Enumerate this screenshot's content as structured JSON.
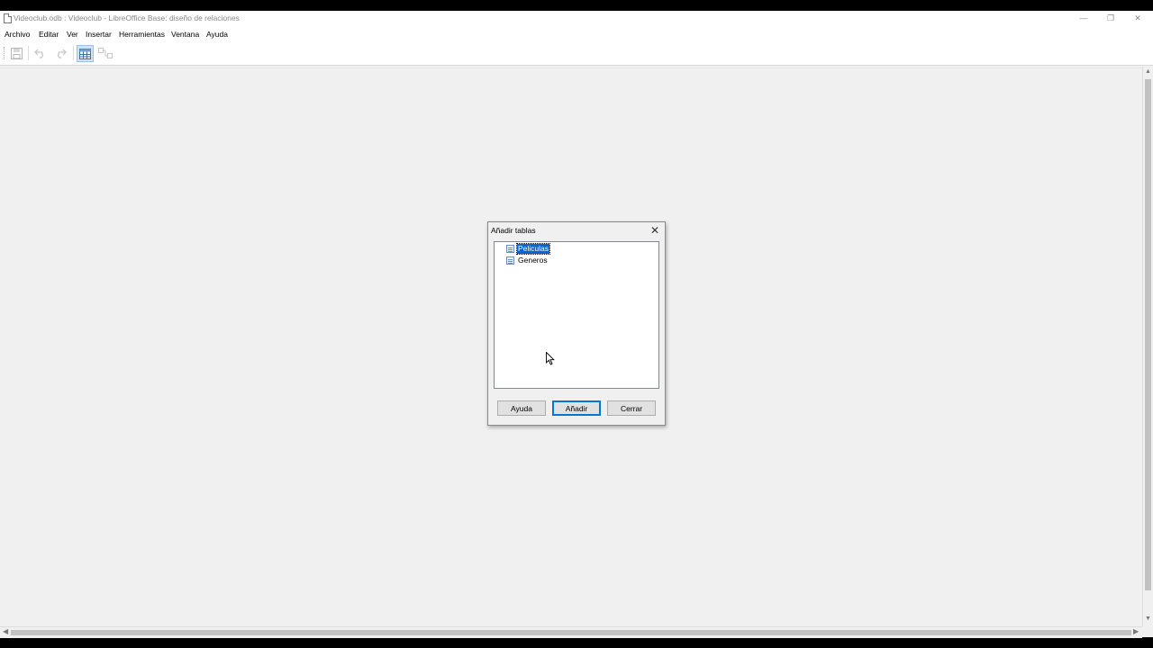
{
  "window": {
    "title": "Videoclub.odb : Videoclub - LibreOffice Base: diseño de relaciones"
  },
  "menu": [
    "Archivo",
    "Editar",
    "Ver",
    "Insertar",
    "Herramientas",
    "Ventana",
    "Ayuda"
  ],
  "toolbar": {
    "icons": [
      "save-icon",
      "undo-icon",
      "redo-icon",
      "add-tables-icon",
      "new-relation-icon"
    ]
  },
  "dialog": {
    "title": "Añadir tablas",
    "tables": [
      "Peliculas",
      "Generos"
    ],
    "selected": "Peliculas",
    "buttons": {
      "help": "Ayuda",
      "add": "Añadir",
      "close": "Cerrar"
    }
  },
  "colors": {
    "selection": "#0a64d2",
    "default_button_border": "#0078d7"
  }
}
